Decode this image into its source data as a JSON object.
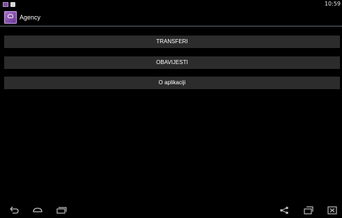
{
  "status_bar": {
    "time": "10:59",
    "icons": [
      "app-notification-icon",
      "shopping-bag-icon"
    ]
  },
  "action_bar": {
    "title": "Agency",
    "icon": "app-launcher-icon"
  },
  "menu": {
    "items": [
      {
        "label": "TRANSFERI"
      },
      {
        "label": "OBAVIJESTI"
      },
      {
        "label": "O aplikaciji"
      }
    ]
  },
  "nav_bar": {
    "icons": [
      "back-icon",
      "home-icon",
      "recent-apps-icon",
      "share-icon",
      "window-icon",
      "close-icon"
    ]
  },
  "colors": {
    "background": "#000000",
    "button_bg": "#2c2c2c",
    "divider": "#5c6b7a",
    "app_accent": "#7b4c9a"
  }
}
